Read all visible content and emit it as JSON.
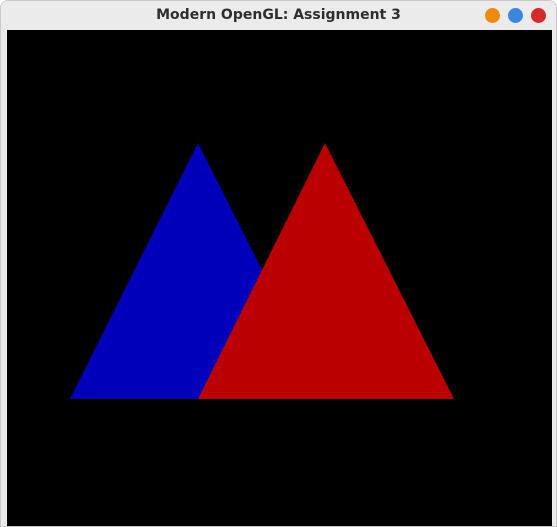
{
  "window": {
    "title": "Modern OpenGL: Assignment 3",
    "controls": {
      "minimize_color": "#f08a0f",
      "maximize_color": "#3c86e0",
      "close_color": "#d42a2a"
    }
  },
  "scene": {
    "background_color": "#000000",
    "triangles": [
      {
        "name": "blue-triangle",
        "color": "#0000bb"
      },
      {
        "name": "red-triangle",
        "color": "#bb0000"
      }
    ]
  }
}
